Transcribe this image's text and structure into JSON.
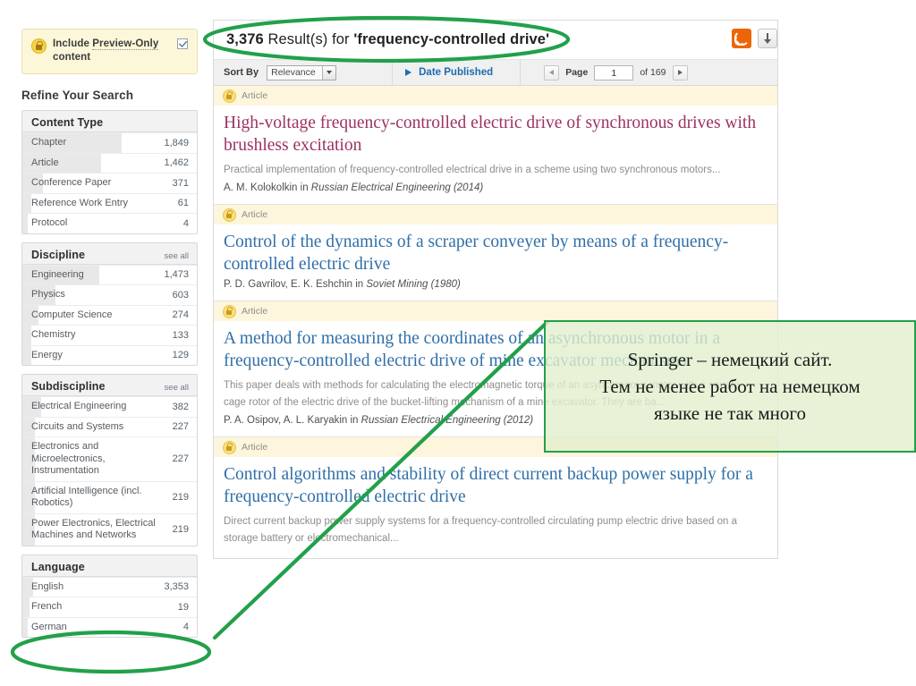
{
  "sidebar": {
    "preview": {
      "label_line1": "Include ",
      "label_dotted": "Preview-Only",
      "label_line2": " content",
      "checkbox_checked": "true",
      "lock_icon": "lock-icon"
    },
    "refine_title": "Refine Your Search",
    "facets": [
      {
        "title": "Content Type",
        "see_all": "",
        "rows": [
          {
            "label": "Chapter",
            "count": "1,849",
            "bar_pct": 57
          },
          {
            "label": "Article",
            "count": "1,462",
            "bar_pct": 45
          },
          {
            "label": "Conference Paper",
            "count": "371",
            "bar_pct": 12
          },
          {
            "label": "Reference Work Entry",
            "count": "61",
            "bar_pct": 5
          },
          {
            "label": "Protocol",
            "count": "4",
            "bar_pct": 3
          }
        ]
      },
      {
        "title": "Discipline",
        "see_all": "see all",
        "rows": [
          {
            "label": "Engineering",
            "count": "1,473",
            "bar_pct": 44
          },
          {
            "label": "Physics",
            "count": "603",
            "bar_pct": 19
          },
          {
            "label": "Computer Science",
            "count": "274",
            "bar_pct": 9
          },
          {
            "label": "Chemistry",
            "count": "133",
            "bar_pct": 5
          },
          {
            "label": "Energy",
            "count": "129",
            "bar_pct": 5
          }
        ]
      },
      {
        "title": "Subdiscipline",
        "see_all": "see all",
        "rows": [
          {
            "label": "Electrical Engineering",
            "count": "382",
            "bar_pct": 11
          },
          {
            "label": "Circuits and Systems",
            "count": "227",
            "bar_pct": 7
          },
          {
            "label": "Electronics and Microelectronics, Instrumentation",
            "count": "227",
            "bar_pct": 7
          },
          {
            "label": "Artificial Intelligence (incl. Robotics)",
            "count": "219",
            "bar_pct": 7
          },
          {
            "label": "Power Electronics, Electrical Machines and Networks",
            "count": "219",
            "bar_pct": 7
          }
        ]
      },
      {
        "title": "Language",
        "see_all": "",
        "rows": [
          {
            "label": "English",
            "count": "3,353",
            "bar_pct": 6
          },
          {
            "label": "French",
            "count": "19",
            "bar_pct": 4
          },
          {
            "label": "German",
            "count": "4",
            "bar_pct": 3
          }
        ]
      }
    ]
  },
  "header": {
    "count": "3,376",
    "result_text": " Result(s) for ",
    "query": "'frequency-controlled drive'",
    "rss_icon": "rss-icon",
    "download_icon": "download-icon"
  },
  "toolbar": {
    "sort_by_label": "Sort By",
    "sort_value": "Relevance",
    "date_published_label": "Date Published",
    "page_label": "Page",
    "page_value": "1",
    "page_of": "of 169",
    "prev_icon": "chevron-left-icon",
    "next_icon": "chevron-right-icon"
  },
  "results": [
    {
      "badge": "Article",
      "title": "High-voltage frequency-controlled electric drive of synchronous drives with brushless excitation",
      "visited": "true",
      "snippet": "Practical implementation of frequency-controlled electrical drive in a scheme using two synchronous motors...",
      "authors": "A. M. Kolokolkin in ",
      "journal": "Russian Electrical Engineering (2014)"
    },
    {
      "badge": "Article",
      "title": "Control of the dynamics of a scraper conveyer by means of a frequency-controlled electric drive",
      "visited": "false",
      "snippet": "",
      "authors": "P. D. Gavrilov, E. K. Eshchin in ",
      "journal": "Soviet Mining (1980)"
    },
    {
      "badge": "Article",
      "title": "A method for measuring the coordinates of an asynchronous motor in a frequency-controlled electric drive of mine excavator mechanisms",
      "visited": "false",
      "snippet": "This paper deals with methods for calculating the electromagnetic torque of an asynchronous motor with a square-cage rotor of the electric drive of the bucket-lifting mechanism of a mine excavator. They are ba...",
      "authors": "P. A. Osipov, A. L. Karyakin in ",
      "journal": "Russian Electrical Engineering (2012)"
    },
    {
      "badge": "Article",
      "title": "Control algorithms and stability of direct current backup power supply for a frequency-controlled electric drive",
      "visited": "false",
      "snippet": "Direct current backup power supply systems for a frequency-controlled circulating pump electric drive based on a storage battery or electromechanical...",
      "authors": "",
      "journal": ""
    }
  ],
  "annotation": {
    "callout_line1": "Springer – немецкий сайт.",
    "callout_line2": "Тем не менее работ на немецком",
    "callout_line3": "языке не так много",
    "accent_color": "#22a04a",
    "callout_bg": "#e2efcd"
  }
}
